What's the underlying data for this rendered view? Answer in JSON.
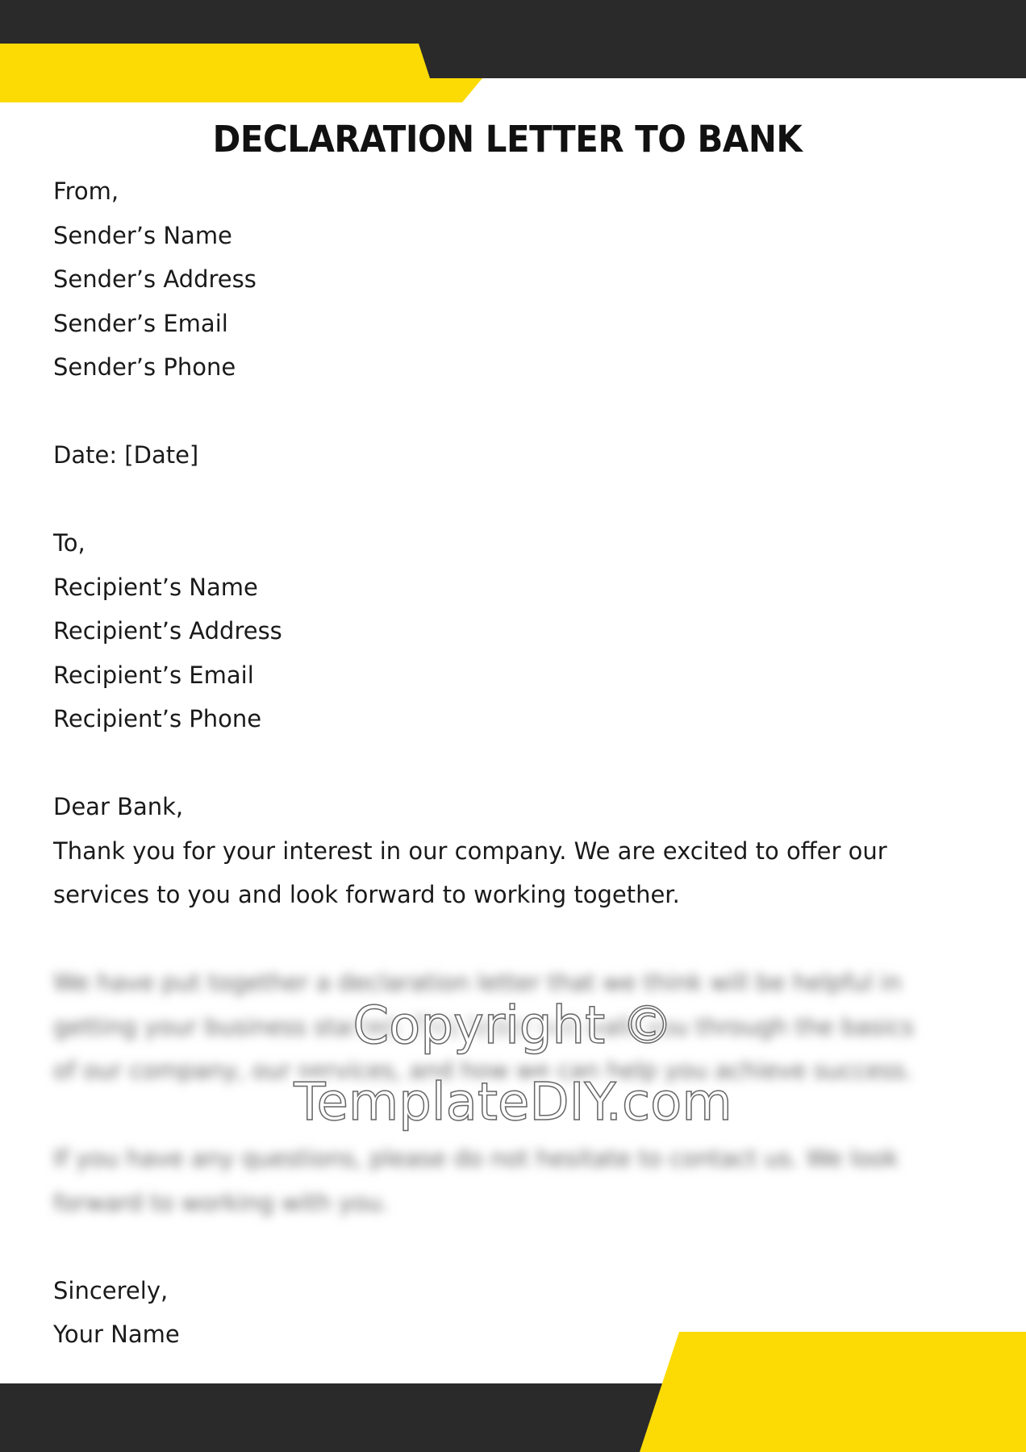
{
  "colors": {
    "dark": "#2a2a2b",
    "yellow": "#fcdb05"
  },
  "title": "DECLARATION LETTER TO BANK",
  "sender": {
    "label": "From,",
    "lines": [
      "Sender’s Name",
      "Sender’s Address",
      "Sender’s Email",
      "Sender’s Phone"
    ]
  },
  "date": "Date: [Date]",
  "recipient": {
    "label": "To,",
    "lines": [
      "Recipient’s Name",
      "Recipient’s Address",
      "Recipient’s Email",
      "Recipient’s Phone"
    ]
  },
  "salutation": "Dear Bank,",
  "paragraph1": [
    "Thank you for your interest in our company. We are excited to offer our",
    "services to you and look forward to working together."
  ],
  "paragraph2_blurred": [
    "We have put together a declaration letter that we think will be helpful in",
    "getting your business started. This letter will walk you through the basics",
    "of our company, our services, and how we can help you achieve success."
  ],
  "paragraph3_blurred": [
    "If you have any questions, please do not hesitate to contact us. We look",
    "forward to working with you."
  ],
  "closing": "Sincerely,",
  "signature": "Your Name",
  "watermark": {
    "line1": "Copyright ©",
    "line2": "TemplateDIY.com"
  }
}
